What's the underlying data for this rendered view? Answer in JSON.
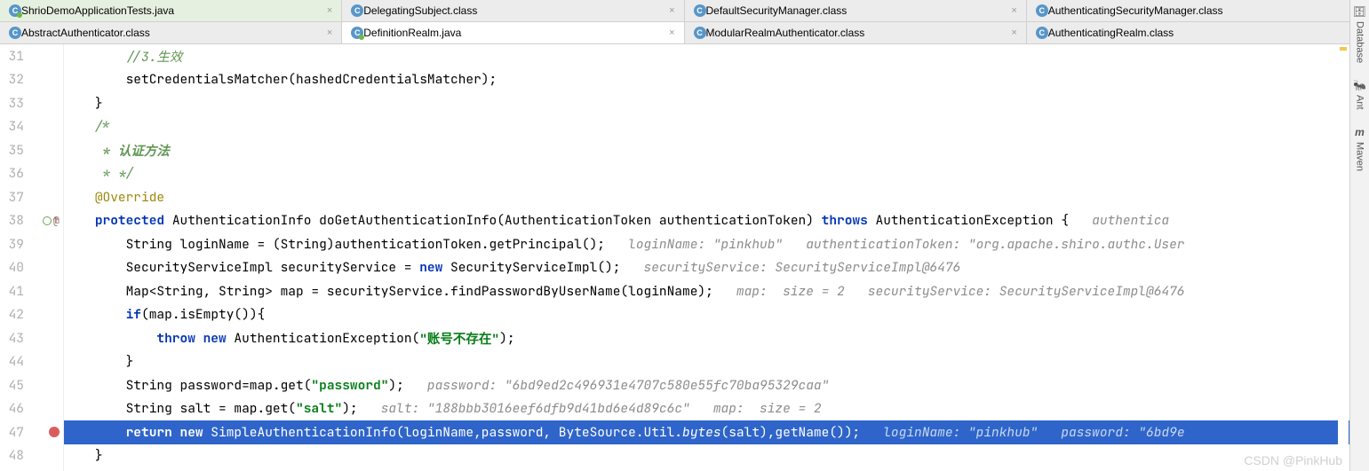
{
  "tabs_row1": [
    {
      "icon": "j",
      "label": "ShrioDemoApplicationTests.java",
      "pinned": true
    },
    {
      "icon": "c",
      "label": "DelegatingSubject.class"
    },
    {
      "icon": "c",
      "label": "DefaultSecurityManager.class"
    },
    {
      "icon": "c",
      "label": "AuthenticatingSecurityManager.class"
    }
  ],
  "tabs_row2": [
    {
      "icon": "c",
      "label": "AbstractAuthenticator.class"
    },
    {
      "icon": "j",
      "label": "DefinitionRealm.java",
      "active": true
    },
    {
      "icon": "c",
      "label": "ModularRealmAuthenticator.class"
    },
    {
      "icon": "c",
      "label": "AuthenticatingRealm.class"
    }
  ],
  "right_tools": [
    {
      "icon": "🗄",
      "label": "Database"
    },
    {
      "icon": "🐜",
      "label": "Ant"
    },
    {
      "icon": "m",
      "label": "Maven"
    }
  ],
  "lines": {
    "31": "//3.生效",
    "32": "setCredentialsMatcher(hashedCredentialsMatcher);",
    "33": "}",
    "34": "/*",
    "35": " * 认证方法",
    "36": " * */",
    "37": "@Override",
    "38": "protected AuthenticationInfo doGetAuthenticationInfo(AuthenticationToken authenticationToken) throws AuthenticationException {   authenticationToken:",
    "39_code": "String loginName = (String)authenticationToken.getPrincipal();",
    "39_inlay": "   loginName: \"pinkhub\"   authenticationToken: \"org.apache.shiro.authc.User",
    "40_code": "SecurityServiceImpl securityService = new SecurityServiceImpl();",
    "40_inlay": "   securityService: SecurityServiceImpl@6476",
    "41_code": "Map<String, String> map = securityService.findPasswordByUserName(loginName);",
    "41_inlay": "   map:  size = 2   securityService: SecurityServiceImpl@6476",
    "42": "if(map.isEmpty()){",
    "43_throw": "throw new AuthenticationException(",
    "43_str": "\"账号不存在\"",
    "43_end": ");",
    "44": "}",
    "45_code": "String password=map.get(",
    "45_str": "\"password\"",
    "45_end": ");",
    "45_inlay": "   password: \"6bd9ed2c496931e4707c580e55fc70ba95329caa\"",
    "46_code": "String salt = map.get(",
    "46_str": "\"salt\"",
    "46_end": ");",
    "46_inlay": "   salt: \"188bbb3016eef6dfb9d41bd6e4d89c6c\"   map:  size = 2",
    "47_code": "return new SimpleAuthenticationInfo(loginName,password, ByteSource.Util.",
    "47_ital": "bytes",
    "47_code2": "(salt),getName());",
    "47_inlay": "   loginName: \"pinkhub\"   password: \"6bd9e",
    "48": "}"
  },
  "watermark": "CSDN @PinkHub"
}
